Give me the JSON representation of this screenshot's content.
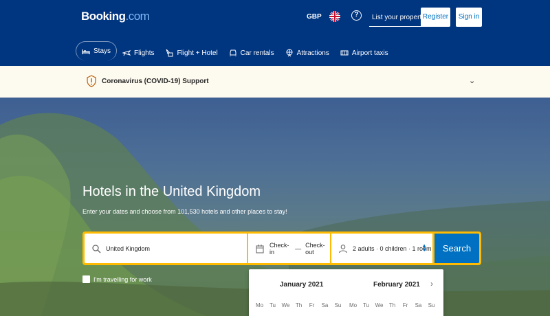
{
  "header": {
    "logo_main": "Booking",
    "logo_suffix": ".com",
    "currency": "GBP",
    "help_glyph": "?",
    "list_property": "List your property",
    "register": "Register",
    "sign_in": "Sign in"
  },
  "nav": {
    "items": [
      {
        "label": "Stays",
        "icon": "bed-icon"
      },
      {
        "label": "Flights",
        "icon": "plane-icon"
      },
      {
        "label": "Flight + Hotel",
        "icon": "flight-hotel-icon"
      },
      {
        "label": "Car rentals",
        "icon": "car-icon"
      },
      {
        "label": "Attractions",
        "icon": "attractions-icon"
      },
      {
        "label": "Airport taxis",
        "icon": "taxi-icon"
      }
    ]
  },
  "banner": {
    "text": "Coronavirus (COVID-19) Support"
  },
  "hero": {
    "title": "Hotels in the United Kingdom",
    "subtitle": "Enter your dates and choose from 101,530 hotels and other places to stay!"
  },
  "search": {
    "destination_value": "United Kingdom",
    "check_in": "Check-in",
    "dash": "—",
    "check_out": "Check-out",
    "guests": "2 adults · 0 children · 1 room",
    "button": "Search"
  },
  "work_travel": "I'm travelling for work",
  "calendar": {
    "month1": "January 2021",
    "month2": "February 2021",
    "days": [
      "Mo",
      "Tu",
      "We",
      "Th",
      "Fr",
      "Sa",
      "Su"
    ]
  },
  "colors": {
    "brand_blue": "#003580",
    "action_blue": "#0071c2",
    "search_yellow": "#febb02",
    "banner_bg": "#fdfaef"
  }
}
